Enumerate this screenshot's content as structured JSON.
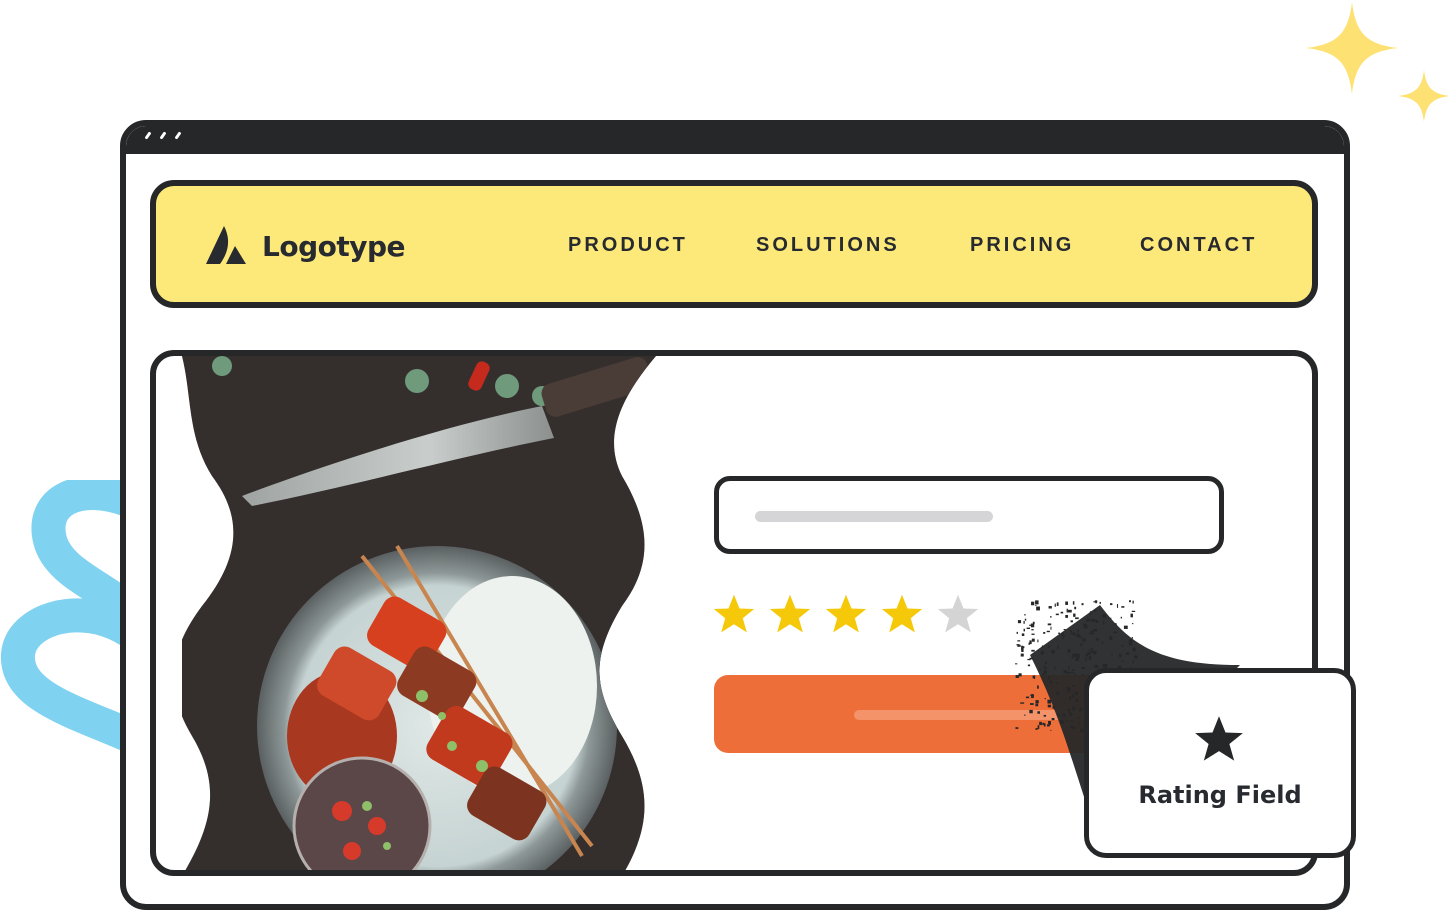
{
  "window": {
    "titlebar_dots": 3
  },
  "navbar": {
    "logo_text": "Logotype",
    "logo_icon": "logo-mark-icon",
    "links": [
      {
        "label": "PRODUCT"
      },
      {
        "label": "SOLUTIONS"
      },
      {
        "label": "PRICING"
      },
      {
        "label": "CONTACT"
      }
    ]
  },
  "content": {
    "image_subject": "grilled skewers with rice, salsa and chef knife",
    "text_input": {
      "placeholder": ""
    },
    "rating": {
      "value": 4,
      "max": 5,
      "filled_color": "#f5c90a",
      "empty_color": "#d4d4d4"
    },
    "submit_button": {
      "label": "",
      "color": "#ee6e3a"
    }
  },
  "tooltip": {
    "icon": "star-icon",
    "label": "Rating Field"
  },
  "colors": {
    "nav_bg": "#fde97a",
    "outline": "#262728",
    "sparkle": "#fde173",
    "swirl": "#7fd2f0"
  }
}
